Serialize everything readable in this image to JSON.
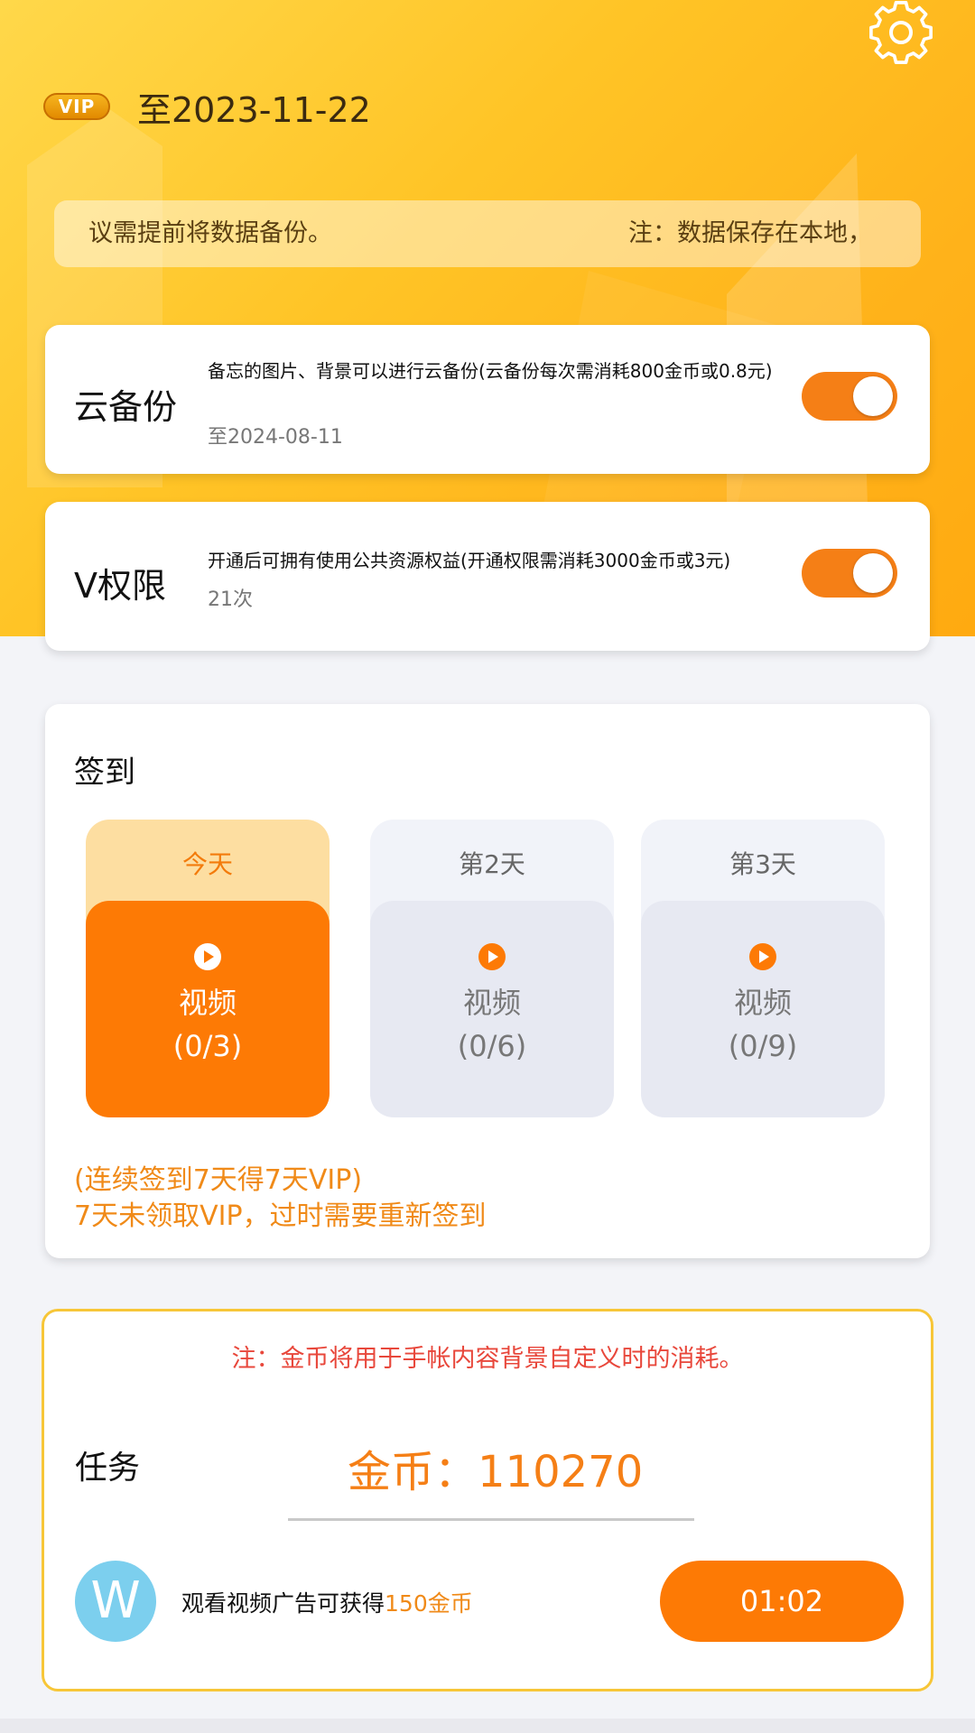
{
  "header": {
    "vip_badge": "VIP",
    "vip_expiry": "至2023-11-22",
    "notice_left": "议需提前将数据备份。",
    "notice_right": "注：数据保存在本地，",
    "settings_icon": "gear-icon"
  },
  "features": [
    {
      "title": "云备份",
      "desc": "备忘的图片、背景可以进行云备份(云备份每次需消耗800金币或0.8元)",
      "sub": "至2024-08-11",
      "enabled": true
    },
    {
      "title": "V权限",
      "desc": "开通后可拥有使用公共资源权益(开通权限需消耗3000金币或3元)",
      "sub": "21次",
      "enabled": true
    }
  ],
  "signin": {
    "title": "签到",
    "days": [
      {
        "label": "今天",
        "action": "视频",
        "count": "(0/3)",
        "active": true
      },
      {
        "label": "第2天",
        "action": "视频",
        "count": "(0/6)",
        "active": false
      },
      {
        "label": "第3天",
        "action": "视频",
        "count": "(0/9)",
        "active": false
      }
    ],
    "note1": "(连续签到7天得7天VIP)",
    "note2": "7天未领取VIP，过时需要重新签到"
  },
  "task": {
    "warning": "注：金币将用于手帐内容背景自定义时的消耗。",
    "title": "任务",
    "coins": "金币：110270",
    "avatar_letter": "W",
    "text_prefix": "观看视频广告可获得",
    "text_highlight": "150金币",
    "timer": "01:02"
  },
  "colors": {
    "accent": "#fd7a05",
    "hero": "#ffc426",
    "warning": "#e8473b",
    "note": "#f08a18"
  }
}
